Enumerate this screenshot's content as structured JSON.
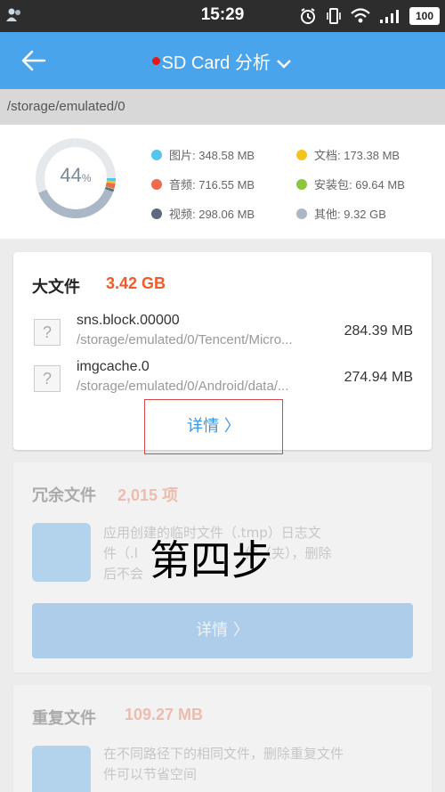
{
  "status_bar": {
    "time": "15:29",
    "battery": "100"
  },
  "app_bar": {
    "title": "SD Card 分析"
  },
  "path": "/storage/emulated/0",
  "summary": {
    "percent": "44",
    "percent_unit": "%",
    "usage_fraction": 0.44,
    "legend": [
      {
        "label": "图片: 348.58 MB",
        "color": "#55c5ee"
      },
      {
        "label": "文档: 173.38 MB",
        "color": "#f4c41e"
      },
      {
        "label": "音频: 716.55 MB",
        "color": "#ef6a4f"
      },
      {
        "label": "安装包: 69.64 MB",
        "color": "#8cc63f"
      },
      {
        "label": "视频: 298.06 MB",
        "color": "#5a6b7e"
      },
      {
        "label": "其他: 9.32 GB",
        "color": "#a9b7c6"
      }
    ]
  },
  "large_files": {
    "title": "大文件",
    "size": "3.42 GB",
    "items": [
      {
        "icon": "?",
        "name": "sns.block.00000",
        "path": "/storage/emulated/0/Tencent/Micro...",
        "size": "284.39 MB"
      },
      {
        "icon": "?",
        "name": "imgcache.0",
        "path": "/storage/emulated/0/Android/data/...",
        "size": "274.94 MB"
      }
    ],
    "detail_label": "详情 〉"
  },
  "redundant_files": {
    "title": "冗余文件",
    "count": "2,015 项",
    "desc_line1": "应用创建的临时文件（.tmp）日志文",
    "desc_line2": "件（.l",
    "desc_line2b": "件（夹），删除",
    "desc_line3": "后不会",
    "detail_label": "详情 〉"
  },
  "duplicate_files": {
    "title": "重复文件",
    "size": "109.27 MB",
    "desc_line1": "在不同路径下的相同文件，删除重复文件",
    "desc_line2": "件可以节省空间"
  },
  "overlay_step": "第四步"
}
